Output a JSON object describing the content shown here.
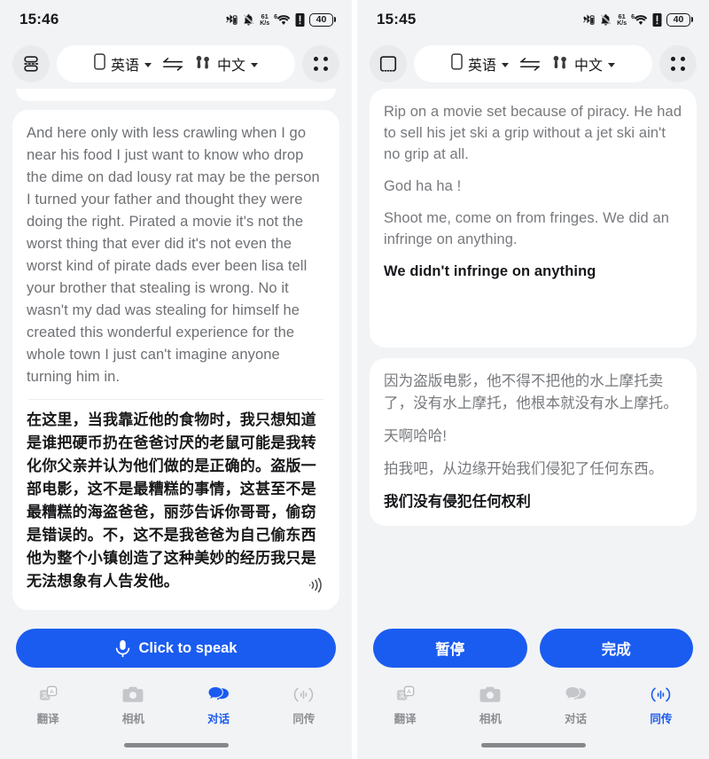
{
  "left": {
    "status": {
      "time": "15:46",
      "net_speed_value": "61",
      "net_speed_unit": "K/s",
      "wifi_generation": "6",
      "battery_level": "40"
    },
    "toolbar": {
      "view_toggle_icon": "split-view-icon",
      "source": {
        "device_icon": "phone-icon",
        "label": "英语",
        "caret_icon": "chevron-down-icon"
      },
      "swap_icon": "swap-arrows-icon",
      "target": {
        "device_icon": "earbuds-icon",
        "label": "中文",
        "caret_icon": "chevron-down-icon"
      },
      "more_icon": "four-dots-icon"
    },
    "card": {
      "english": "And here only with less crawling when I go near his food I just want to know who drop the dime on dad lousy rat may be the person I turned your father and thought they were doing the right. Pirated a movie it's not the worst thing that ever did it's not even the worst kind of pirate dads ever been lisa tell your brother that stealing is wrong. No it wasn't my dad was stealing for himself he created this wonderful experience for the whole town I just can't imagine anyone turning him in.",
      "chinese": "在这里，当我靠近他的食物时，我只想知道是谁把硬币扔在爸爸讨厌的老鼠可能是我转化你父亲并认为他们做的是正确的。盗版一部电影，这不是最糟糕的事情，这甚至不是最糟糕的海盗爸爸，丽莎告诉你哥哥，偷窃是错误的。不，这不是我爸爸为自己偷东西他为整个小镇创造了这种美妙的经历我只是无法想象有人告发他。",
      "speaker_icon": "volume-icon"
    },
    "action": {
      "mic_icon": "microphone-icon",
      "label": "Click to speak"
    },
    "nav": [
      {
        "icon": "translate-icon",
        "label": "翻译",
        "active": false
      },
      {
        "icon": "camera-icon",
        "label": "相机",
        "active": false
      },
      {
        "icon": "chat-bubbles-icon",
        "label": "对话",
        "active": true
      },
      {
        "icon": "waveform-icon",
        "label": "同传",
        "active": false
      }
    ]
  },
  "right": {
    "status": {
      "time": "15:45",
      "net_speed_value": "61",
      "net_speed_unit": "K/s",
      "wifi_generation": "6",
      "battery_level": "40"
    },
    "toolbar": {
      "view_toggle_icon": "fullscreen-view-icon",
      "source": {
        "device_icon": "phone-icon",
        "label": "英语",
        "caret_icon": "chevron-down-icon"
      },
      "swap_icon": "swap-arrows-icon",
      "target": {
        "device_icon": "earbuds-icon",
        "label": "中文",
        "caret_icon": "chevron-down-icon"
      },
      "more_icon": "four-dots-icon"
    },
    "source_card": [
      {
        "text": "Rip on a movie set because of piracy. He had to sell his jet ski a grip without a jet ski ain't no grip at all.",
        "active": false
      },
      {
        "text": "God ha ha !",
        "active": false
      },
      {
        "text": "Shoot me, come on from fringes. We did an infringe on anything.",
        "active": false
      },
      {
        "text": "We didn't infringe on anything",
        "active": true
      }
    ],
    "target_card": [
      {
        "text": "因为盗版电影，他不得不把他的水上摩托卖了，没有水上摩托，他根本就没有水上摩托。",
        "active": false
      },
      {
        "text": "天啊哈哈!",
        "active": false
      },
      {
        "text": "拍我吧，从边缘开始我们侵犯了任何东西。",
        "active": false
      },
      {
        "text": "我们没有侵犯任何权利",
        "active": true
      }
    ],
    "actions": {
      "pause_label": "暂停",
      "done_label": "完成"
    },
    "nav": [
      {
        "icon": "translate-icon",
        "label": "翻译",
        "active": false
      },
      {
        "icon": "camera-icon",
        "label": "相机",
        "active": false
      },
      {
        "icon": "chat-bubbles-icon",
        "label": "对话",
        "active": false
      },
      {
        "icon": "waveform-icon",
        "label": "同传",
        "active": true
      }
    ]
  },
  "colors": {
    "accent": "#1a5cf0",
    "page_bg": "#f2f3f5",
    "card_bg": "#ffffff",
    "muted_text": "#77797d",
    "primary_text": "#18181a"
  }
}
